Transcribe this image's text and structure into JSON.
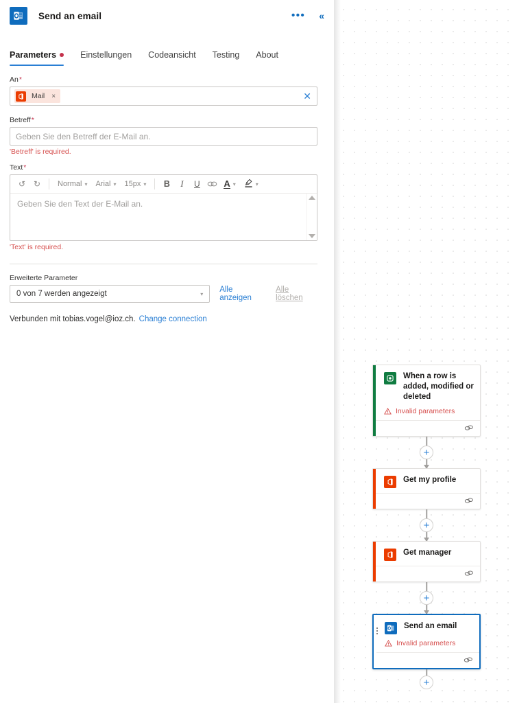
{
  "panel": {
    "app_icon": "outlook-icon",
    "title": "Send an email",
    "more_label": "•••",
    "collapse_label": "«",
    "tabs": [
      {
        "label": "Parameters",
        "active": true,
        "dot": true
      },
      {
        "label": "Einstellungen",
        "active": false,
        "dot": false
      },
      {
        "label": "Codeansicht",
        "active": false,
        "dot": false
      },
      {
        "label": "Testing",
        "active": false,
        "dot": false
      },
      {
        "label": "About",
        "active": false,
        "dot": false
      }
    ],
    "fields": {
      "to": {
        "label": "An",
        "required_mark": "*",
        "chip_text": "Mail",
        "chip_remove": "×",
        "clear_label": "✕"
      },
      "subject": {
        "label": "Betreff",
        "required_mark": "*",
        "value": "",
        "placeholder": "Geben Sie den Betreff der E-Mail an.",
        "error": "'Betreff' is required."
      },
      "body": {
        "label": "Text",
        "required_mark": "*",
        "value": "",
        "placeholder": "Geben Sie den Text der E-Mail an.",
        "error": "'Text' is required.",
        "toolbar": {
          "undo": "↺",
          "redo": "↻",
          "style": "Normal",
          "font": "Arial",
          "size": "15px",
          "bold": "B",
          "italic": "I",
          "underline": "U",
          "link": "∞",
          "font_color": "A",
          "highlight": "✐",
          "chevron": "⌄"
        }
      }
    },
    "advanced": {
      "label": "Erweiterte Parameter",
      "select_value": "0 von 7 werden angezeigt",
      "show_all": "Alle anzeigen",
      "clear_all": "Alle löschen"
    },
    "connection": {
      "text": "Verbunden mit tobias.vogel@ioz.ch.",
      "change_link": "Change connection"
    }
  },
  "canvas": {
    "plus_label": "+",
    "warning_text": "Invalid parameters",
    "nodes": [
      {
        "title": "When a row is added, modified or deleted",
        "icon": "dataverse-icon",
        "accent": "#107c41",
        "warning": "Invalid parameters",
        "selected": false
      },
      {
        "title": "Get my profile",
        "icon": "office365-icon",
        "accent": "#eb3c00",
        "warning": "",
        "selected": false
      },
      {
        "title": "Get manager",
        "icon": "office365-icon",
        "accent": "#eb3c00",
        "warning": "",
        "selected": false
      },
      {
        "title": "Send an email",
        "icon": "outlook-icon",
        "accent": "#0f6cbd",
        "warning": "Invalid parameters",
        "selected": true
      }
    ]
  },
  "colors": {
    "accent_blue": "#0f6cbd",
    "link_blue": "#2a7fd4",
    "error_red": "#d6504f",
    "dot_red": "#c4314b",
    "green": "#107c41",
    "orange": "#eb3c00"
  }
}
